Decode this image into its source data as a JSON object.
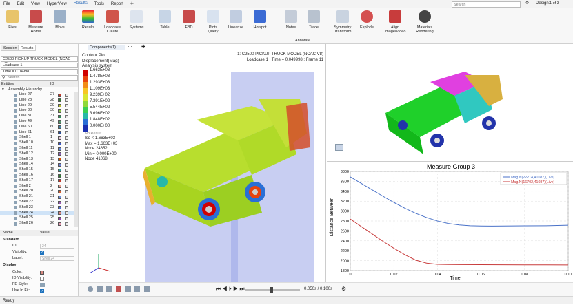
{
  "menubar": {
    "items": [
      "File",
      "Edit",
      "View",
      "HyperView",
      "Results",
      "Tools",
      "Report"
    ],
    "active": "Results",
    "search_placeholder": "Search",
    "session": "Design1",
    "pages": "1 of 3"
  },
  "ribbon": {
    "buttons": [
      "Files",
      "Measure",
      "Move",
      "Results",
      "Loadcase",
      "Systems",
      "Table",
      "FBD",
      "Plots",
      "Linearize",
      "Hotspot",
      "Notes",
      "Trace",
      "Symmetry",
      "Explode",
      "Align",
      "Materials"
    ],
    "subs": {
      "Measure": "Home",
      "Loadcase": "Create",
      "Plots": "Query",
      "Symmetry": "Transform",
      "Align": "Image/Video",
      "Materials": "Rendering"
    },
    "groups": {
      "annotate": "Annotate"
    }
  },
  "left": {
    "tabs": [
      "Session",
      "Results"
    ],
    "model": "C2500 PICKUP TRUCK MODEL (NCAC V8)",
    "loadcase": "Loadcase 1",
    "time": "Time = 0.04998",
    "search_placeholder": "Search",
    "entities_label": "Entities",
    "id_label": "ID",
    "root": "Assembly Hierarchy",
    "rows": [
      {
        "n": "Line 27",
        "id": "27",
        "c": "#c0392b"
      },
      {
        "n": "Line 28",
        "id": "28",
        "c": "#2e7d32"
      },
      {
        "n": "Line 29",
        "id": "29",
        "c": "#b5bd2a"
      },
      {
        "n": "Line 30",
        "id": "30",
        "c": "#8bc34a"
      },
      {
        "n": "Line 31",
        "id": "31",
        "c": "#2e8b57"
      },
      {
        "n": "Line 49",
        "id": "49",
        "c": "#4e9a6a"
      },
      {
        "n": "Line 60",
        "id": "60",
        "c": "#3f7f9f"
      },
      {
        "n": "Line 61",
        "id": "61",
        "c": "#2a4f9a"
      },
      {
        "n": "Shell 1",
        "id": "1",
        "c": "#e8c7d8"
      },
      {
        "n": "Shell 10",
        "id": "10",
        "c": "#3b56c4"
      },
      {
        "n": "Shell 11",
        "id": "11",
        "c": "#5f86d6"
      },
      {
        "n": "Shell 12",
        "id": "12",
        "c": "#8a5fb5"
      },
      {
        "n": "Shell 13",
        "id": "13",
        "c": "#d35400"
      },
      {
        "n": "Shell 14",
        "id": "14",
        "c": "#6b7ed8"
      },
      {
        "n": "Shell 15",
        "id": "15",
        "c": "#2aa3a3"
      },
      {
        "n": "Shell 16",
        "id": "16",
        "c": "#2e7d32"
      },
      {
        "n": "Shell 17",
        "id": "17",
        "c": "#c0392b"
      },
      {
        "n": "Shell 2",
        "id": "2",
        "c": "#e39a8d"
      },
      {
        "n": "Shell 20",
        "id": "20",
        "c": "#d35d2e"
      },
      {
        "n": "Shell 21",
        "id": "21",
        "c": "#6a8cd6"
      },
      {
        "n": "Shell 22",
        "id": "22",
        "c": "#9b59b6"
      },
      {
        "n": "Shell 23",
        "id": "23",
        "c": "#4e6fd0"
      },
      {
        "n": "Shell 24",
        "id": "24",
        "c": "#d98880"
      },
      {
        "n": "Shell 25",
        "id": "25",
        "c": "#8e44ad"
      },
      {
        "n": "Shell 26",
        "id": "26",
        "c": "#e89ab3"
      }
    ],
    "props": {
      "h_name": "Name",
      "h_value": "Value",
      "standard": "Standard",
      "id_k": "ID",
      "id_v": "24",
      "vis_k": "Visibility:",
      "label_k": "Label:",
      "label_v": "Shell 24",
      "display": "Display",
      "color_k": "Color:",
      "idvis_k": "ID Visibility:",
      "fe_k": "FE Style:",
      "use_k": "Use In Fit:"
    }
  },
  "viewport": {
    "components_btn": "Components(1)",
    "contour": [
      "Contour Plot",
      "Displacement(Mag)",
      "Analysis system"
    ],
    "legend": [
      "1.663E+03",
      "1.478E+03",
      "1.293E+03",
      "1.109E+03",
      "9.239E+02",
      "7.391E+02",
      "5.544E+02",
      "3.696E+02",
      "1.848E+02",
      "0.000E+00"
    ],
    "legend_colors": [
      "#d00000",
      "#e8430e",
      "#f28c18",
      "#f7c624",
      "#d9e632",
      "#8fd93a",
      "#3bcf52",
      "#27b8a8",
      "#2a6fd6",
      "#1a2fb0"
    ],
    "no_result": "No Result",
    "info": [
      "Iso < 1.663E+03",
      "Max = 1.663E+03",
      "Node 24652",
      "Min = 0.000E+00",
      "Node 41068"
    ],
    "title1": "1: C2500 PICKUP TRUCK MODEL (NCAC V8)",
    "title2": "Loadcase 1 : Time = 0.049998 : Frame 11"
  },
  "bottombar": {
    "time_text": "0.050s / 0.100s"
  },
  "status": "Ready",
  "chart_data": {
    "type": "line",
    "title": "Measure Group 3",
    "xlabel": "Time",
    "ylabel": "Distance Between",
    "xlim": [
      0,
      0.1
    ],
    "ylim": [
      1800,
      3800
    ],
    "xticks": [
      "0",
      "0.02",
      "0.04",
      "0.06",
      "0.08",
      "0.10"
    ],
    "yticks": [
      "1800",
      "2000",
      "2200",
      "2400",
      "2600",
      "2800",
      "3000",
      "3200",
      "3400",
      "3600",
      "3800"
    ],
    "grid": true,
    "legend_position": "top-right",
    "series": [
      {
        "name": "Mag.N(22214,41087)(Live)",
        "color": "#4a72c8",
        "x": [
          0,
          0.005,
          0.01,
          0.015,
          0.02,
          0.025,
          0.03,
          0.035,
          0.04,
          0.045,
          0.05,
          0.055,
          0.06,
          0.065,
          0.07,
          0.08,
          0.09,
          0.1
        ],
        "y": [
          3690,
          3560,
          3430,
          3300,
          3175,
          3060,
          2955,
          2870,
          2800,
          2750,
          2720,
          2705,
          2700,
          2698,
          2700,
          2702,
          2705,
          2715
        ]
      },
      {
        "name": "Mag.N(16702,41087)(Live)",
        "color": "#c83c3c",
        "x": [
          0,
          0.005,
          0.01,
          0.015,
          0.02,
          0.025,
          0.03,
          0.035,
          0.04,
          0.045,
          0.05,
          0.06,
          0.07,
          0.08,
          0.09,
          0.1
        ],
        "y": [
          2840,
          2690,
          2540,
          2390,
          2250,
          2120,
          2010,
          1950,
          1925,
          1922,
          1920,
          1918,
          1916,
          1915,
          1915,
          1912
        ]
      }
    ]
  }
}
